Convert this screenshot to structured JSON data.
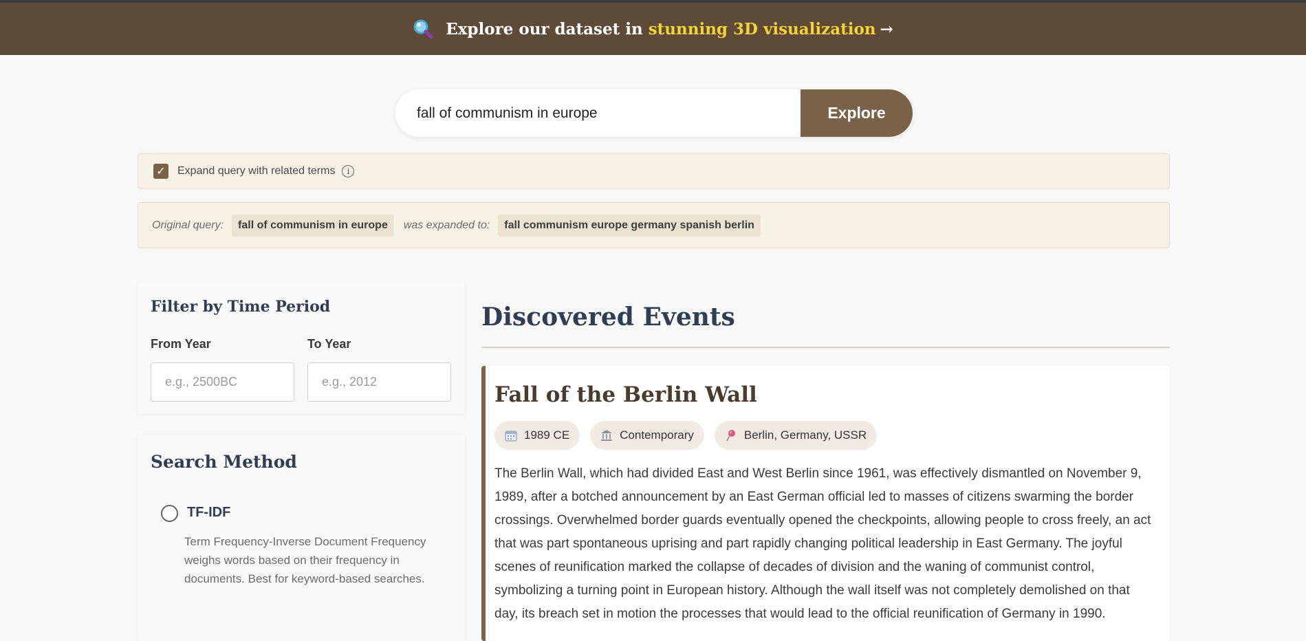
{
  "banner": {
    "text": "Explore our dataset in",
    "highlight": "stunning 3D visualization",
    "arrow": "→",
    "icon": "magnifier-icon"
  },
  "search": {
    "value": "fall of communism in europe",
    "button_label": "Explore"
  },
  "expand": {
    "checked": true,
    "check_glyph": "✓",
    "label": "Expand query with related terms",
    "info_glyph": "i"
  },
  "query_info": {
    "original_label": "Original query:",
    "original_value": "fall of communism in europe",
    "expanded_label": "was expanded to:",
    "expanded_value": "fall communism europe germany spanish berlin"
  },
  "filter": {
    "title": "Filter by Time Period",
    "from_label": "From Year",
    "from_placeholder": "e.g., 2500BC",
    "to_label": "To Year",
    "to_placeholder": "e.g., 2012"
  },
  "search_method": {
    "title": "Search Method",
    "options": [
      {
        "label": "TF-IDF",
        "description": "Term Frequency-Inverse Document Frequency weighs words based on their frequency in documents. Best for keyword-based searches.",
        "selected": false
      }
    ]
  },
  "results": {
    "title": "Discovered Events",
    "events": [
      {
        "title": "Fall of the Berlin Wall",
        "tags": [
          {
            "icon": "calendar-icon",
            "text": "1989 CE"
          },
          {
            "icon": "museum-icon",
            "text": "Contemporary"
          },
          {
            "icon": "pin-icon",
            "text": "Berlin, Germany, USSR"
          }
        ],
        "description": "The Berlin Wall, which had divided East and West Berlin since 1961, was effectively dismantled on November 9, 1989, after a botched announcement by an East German official led to masses of citizens swarming the border crossings. Overwhelmed border guards eventually opened the checkpoints, allowing people to cross freely, an act that was part spontaneous uprising and part rapidly changing political leadership in East Germany. The joyful scenes of reunification marked the collapse of decades of division and the waning of communist control, symbolizing a turning point in European history. Although the wall itself was not completely demolished on that day, its breach set in motion the processes that would lead to the official reunification of Germany in 1990."
      }
    ]
  },
  "colors": {
    "banner_bg": "#5e4b37",
    "accent": "#7a6248",
    "highlight": "#f4d335",
    "heading": "#2f3e53"
  }
}
